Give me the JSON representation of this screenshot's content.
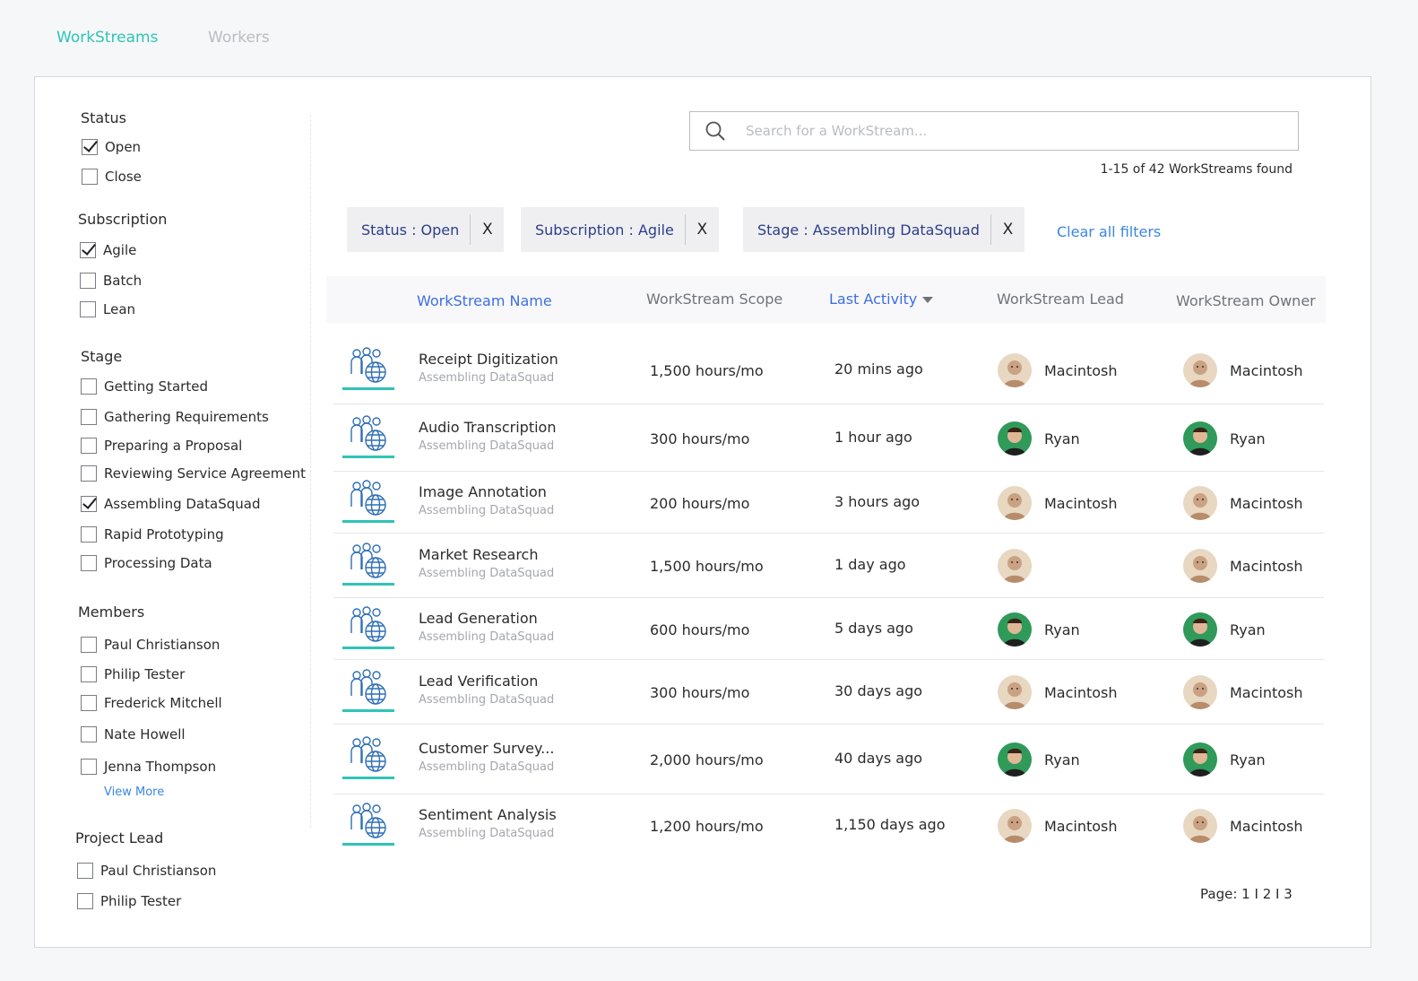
{
  "tabs": [
    {
      "label": "WorkStreams"
    },
    {
      "label": "Workers"
    }
  ],
  "filters": {
    "status": {
      "title": "Status",
      "options": [
        {
          "label": "Open",
          "checked": true
        },
        {
          "label": "Close",
          "checked": false
        }
      ]
    },
    "subscription": {
      "title": "Subscription",
      "options": [
        {
          "label": "Agile",
          "checked": true
        },
        {
          "label": "Batch",
          "checked": false
        },
        {
          "label": "Lean",
          "checked": false
        }
      ]
    },
    "stage": {
      "title": "Stage",
      "options": [
        {
          "label": "Getting Started",
          "checked": false
        },
        {
          "label": "Gathering Requirements",
          "checked": false
        },
        {
          "label": "Preparing a Proposal",
          "checked": false
        },
        {
          "label": "Reviewing Service Agreement",
          "checked": false
        },
        {
          "label": "Assembling DataSquad",
          "checked": true
        },
        {
          "label": "Rapid Prototyping",
          "checked": false
        },
        {
          "label": "Processing Data",
          "checked": false
        }
      ]
    },
    "members": {
      "title": "Members",
      "options": [
        {
          "label": "Paul Christianson",
          "checked": false
        },
        {
          "label": "Philip Tester",
          "checked": false
        },
        {
          "label": "Frederick Mitchell",
          "checked": false
        },
        {
          "label": "Nate Howell",
          "checked": false
        },
        {
          "label": "Jenna Thompson",
          "checked": false
        }
      ],
      "view_more": "View More"
    },
    "project_lead": {
      "title": "Project Lead",
      "options": [
        {
          "label": "Paul Christianson",
          "checked": false
        },
        {
          "label": "Philip Tester",
          "checked": false
        }
      ]
    }
  },
  "search": {
    "placeholder": "Search for a WorkStream...",
    "value": "",
    "icon": "search-icon"
  },
  "results_text": "1-15 of 42 WorkStreams found",
  "active_filters": [
    {
      "label": "Status : Open",
      "remove": "X"
    },
    {
      "label": "Subscription : Agile",
      "remove": "X"
    },
    {
      "label": "Stage : Assembling DataSquad",
      "remove": "X"
    }
  ],
  "clear_all": "Clear all filters",
  "table": {
    "headers": {
      "name": "WorkStream Name",
      "scope": "WorkStream Scope",
      "activity": "Last Activity",
      "lead": "WorkStream Lead",
      "owner": "WorkStream Owner"
    },
    "rows": [
      {
        "name": "Receipt Digitization",
        "stage": "Assembling DataSquad",
        "scope": "1,500 hours/mo",
        "activity": "20 mins ago",
        "lead": "Macintosh",
        "lead_avatar": "macintosh",
        "owner": "Macintosh",
        "owner_avatar": "macintosh"
      },
      {
        "name": "Audio Transcription",
        "stage": "Assembling DataSquad",
        "scope": "300 hours/mo",
        "activity": "1 hour ago",
        "lead": "Ryan",
        "lead_avatar": "ryan",
        "owner": "Ryan",
        "owner_avatar": "ryan"
      },
      {
        "name": "Image Annotation",
        "stage": "Assembling DataSquad",
        "scope": "200 hours/mo",
        "activity": "3 hours ago",
        "lead": "Macintosh",
        "lead_avatar": "macintosh",
        "owner": "Macintosh",
        "owner_avatar": "macintosh"
      },
      {
        "name": "Market Research",
        "stage": "Assembling DataSquad",
        "scope": "1,500 hours/mo",
        "activity": "1 day ago",
        "lead": "",
        "lead_avatar": "macintosh",
        "owner": "Macintosh",
        "owner_avatar": "macintosh"
      },
      {
        "name": "Lead Generation",
        "stage": "Assembling DataSquad",
        "scope": "600 hours/mo",
        "activity": "5 days ago",
        "lead": "Ryan",
        "lead_avatar": "ryan",
        "owner": "Ryan",
        "owner_avatar": "ryan"
      },
      {
        "name": "Lead Verification",
        "stage": "Assembling DataSquad",
        "scope": "300 hours/mo",
        "activity": "30 days ago",
        "lead": "Macintosh",
        "lead_avatar": "macintosh",
        "owner": "Macintosh",
        "owner_avatar": "macintosh"
      },
      {
        "name": "Customer Survey...",
        "stage": "Assembling DataSquad",
        "scope": "2,000 hours/mo",
        "activity": "40 days ago",
        "lead": "Ryan",
        "lead_avatar": "ryan",
        "owner": "Ryan",
        "owner_avatar": "ryan"
      },
      {
        "name": "Sentiment Analysis",
        "stage": "Assembling DataSquad",
        "scope": "1,200 hours/mo",
        "activity": "1,150 days ago",
        "lead": "Macintosh",
        "lead_avatar": "macintosh",
        "owner": "Macintosh",
        "owner_avatar": "macintosh"
      }
    ]
  },
  "pagination": {
    "label": "Page:",
    "pages": [
      "1",
      "2",
      "3"
    ],
    "separator": "I"
  },
  "colors": {
    "accent": "#2ec4b6",
    "link": "#3a86e0",
    "header_link": "#3d6fe0",
    "chip_text": "#2d3e8a"
  }
}
